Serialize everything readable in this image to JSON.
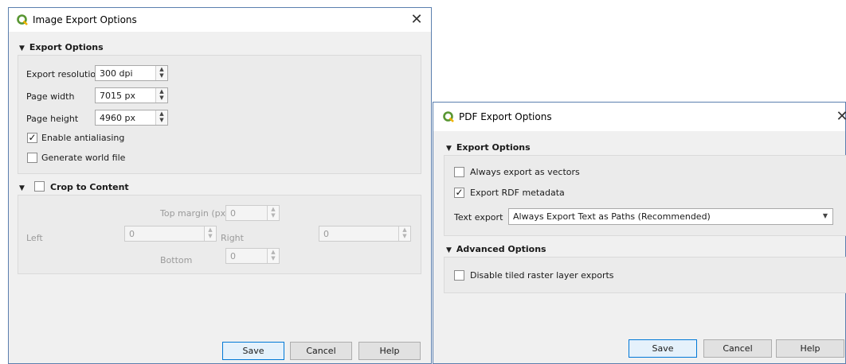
{
  "image_dialog": {
    "title": "Image Export Options",
    "close_glyph": "✕",
    "icon": "qgis-logo-icon",
    "export_options": {
      "header": "Export Options",
      "resolution_label": "Export resolution",
      "resolution_value": "300 dpi",
      "page_width_label": "Page width",
      "page_width_value": "7015 px",
      "page_height_label": "Page height",
      "page_height_value": "4960 px",
      "antialiasing_label": "Enable antialiasing",
      "antialiasing_checked": true,
      "world_file_label": "Generate world file",
      "world_file_checked": false
    },
    "crop": {
      "header": "Crop to Content",
      "checked": false,
      "top_margin_label": "Top margin (px)",
      "top_margin_value": "0",
      "left_label": "Left",
      "left_value": "0",
      "right_label": "Right",
      "right_value": "0",
      "bottom_label": "Bottom",
      "bottom_value": "0"
    },
    "buttons": {
      "save": "Save",
      "cancel": "Cancel",
      "help": "Help"
    }
  },
  "pdf_dialog": {
    "title": "PDF Export Options",
    "close_glyph": "✕",
    "icon": "qgis-logo-icon",
    "export_options": {
      "header": "Export Options",
      "vectors_label": "Always export as vectors",
      "vectors_checked": false,
      "rdf_label": "Export RDF metadata",
      "rdf_checked": true,
      "text_export_label": "Text export",
      "text_export_value": "Always Export Text as Paths (Recommended)"
    },
    "advanced": {
      "header": "Advanced Options",
      "tiled_label": "Disable tiled raster layer exports",
      "tiled_checked": false
    },
    "buttons": {
      "save": "Save",
      "cancel": "Cancel",
      "help": "Help"
    }
  },
  "check_glyph": "✓",
  "collapse_glyph": "▼",
  "spin_glyph": "⬍"
}
